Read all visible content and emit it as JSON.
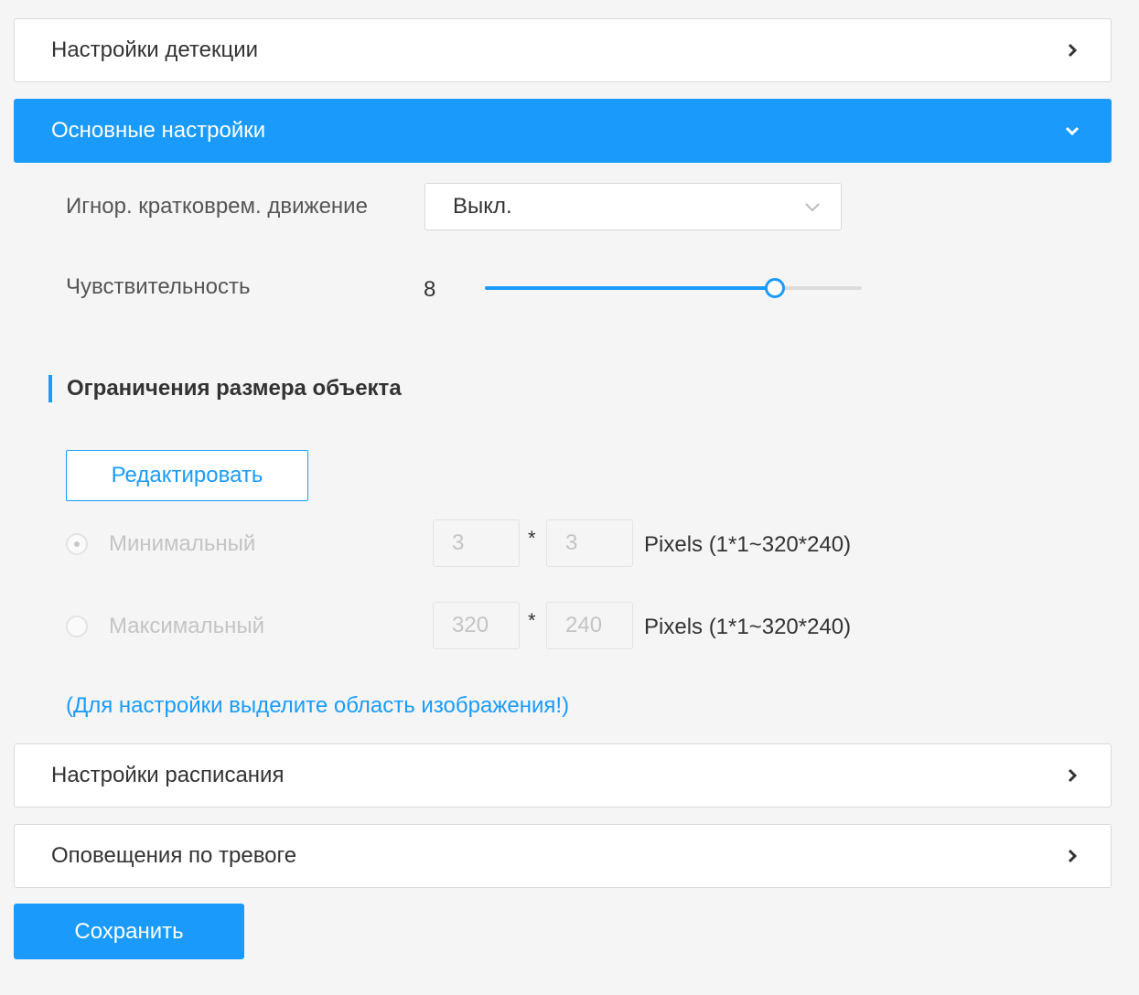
{
  "accent_color": "#1a9bfc",
  "panels": {
    "detection": {
      "title": "Настройки детекции",
      "icon": "chevron-right-icon"
    },
    "basic": {
      "title": "Основные настройки",
      "icon": "chevron-down-icon"
    },
    "schedule": {
      "title": "Настройки расписания",
      "icon": "chevron-right-icon"
    },
    "alarm": {
      "title": "Оповещения по тревоге",
      "icon": "chevron-right-icon"
    }
  },
  "basic": {
    "ignore_motion": {
      "label": "Игнор. кратковрем. движение",
      "value": "Выкл."
    },
    "sensitivity": {
      "label": "Чувствительность",
      "value": "8",
      "fill_fraction": 0.77
    },
    "object_size": {
      "title": "Ограничения размера объекта",
      "edit_label": "Редактировать",
      "min": {
        "label": "Минимальный",
        "checked": true,
        "width": "3",
        "height": "3",
        "separator": "*",
        "range": "Pixels (1*1~320*240)"
      },
      "max": {
        "label": "Максимальный",
        "checked": false,
        "width": "320",
        "height": "240",
        "separator": "*",
        "range": "Pixels (1*1~320*240)"
      },
      "hint": "(Для настройки выделите область изображения!)"
    }
  },
  "save_label": "Сохранить"
}
